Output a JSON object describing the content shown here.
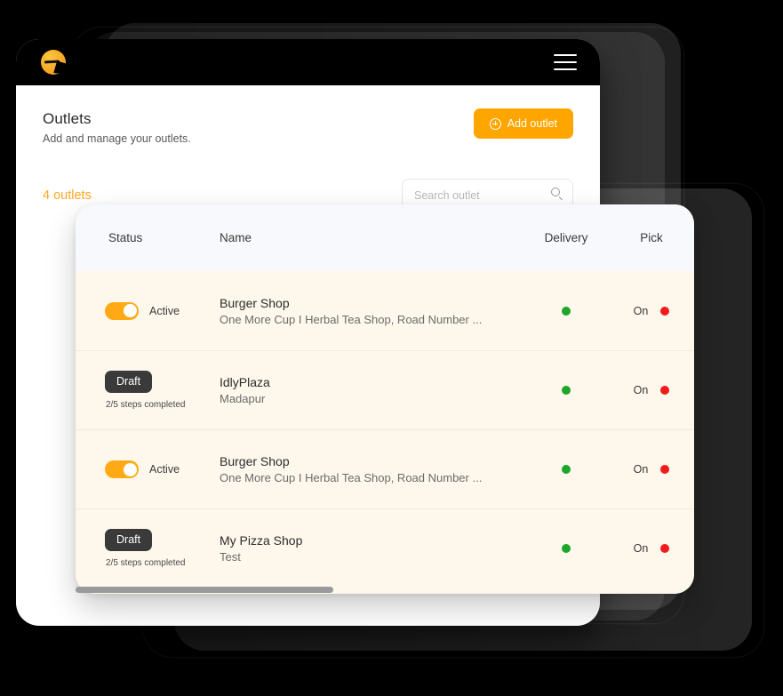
{
  "window": {
    "brand_logo": "e-logo-icon",
    "menu_icon": "hamburger-menu-icon"
  },
  "page": {
    "title": "Outlets",
    "subtitle": "Add and manage your outlets.",
    "add_button_label": "Add outlet",
    "add_button_icon": "plus-circle-icon",
    "outlet_count_label": "4 outlets"
  },
  "search": {
    "placeholder": "Search outlet",
    "value": "",
    "icon": "search-icon"
  },
  "table": {
    "columns": {
      "status": "Status",
      "name": "Name",
      "delivery": "Delivery",
      "pickup": "Pick"
    },
    "rows": [
      {
        "status_type": "active",
        "status_label": "Active",
        "toggle_on": true,
        "name": "Burger Shop",
        "address": "One More Cup I Herbal Tea Shop, Road Number ...",
        "delivery_dot": "green",
        "pickup_state": "On",
        "pickup_dot": "red"
      },
      {
        "status_type": "draft",
        "status_label": "Draft",
        "steps": "2/5 steps completed",
        "name": "IdlyPlaza",
        "address": "Madapur",
        "delivery_dot": "green",
        "pickup_state": "On",
        "pickup_dot": "red"
      },
      {
        "status_type": "active",
        "status_label": "Active",
        "toggle_on": true,
        "name": "Burger Shop",
        "address": "One More Cup I Herbal Tea Shop, Road Number ...",
        "delivery_dot": "green",
        "pickup_state": "On",
        "pickup_dot": "red"
      },
      {
        "status_type": "draft",
        "status_label": "Draft",
        "steps": "2/5 steps completed",
        "name": "My Pizza Shop",
        "address": "Test",
        "delivery_dot": "green",
        "pickup_state": "On",
        "pickup_dot": "red"
      }
    ]
  },
  "colors": {
    "brand_orange": "#FFA500",
    "accent_amber": "#FFA726",
    "toggle_on": "#FFAA14",
    "draft_badge": "#3A3A3A",
    "card_bg": "#FDF7EC",
    "header_bg": "#F8F9FD",
    "dot_green": "#1EA52A",
    "dot_red": "#F21B1B",
    "topbar_bg": "#000000"
  }
}
